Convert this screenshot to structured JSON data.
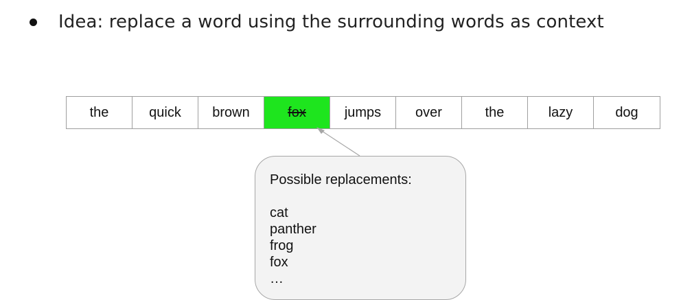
{
  "bullet": {
    "text": "Idea: replace a word using the surrounding words as context"
  },
  "sentence": {
    "words": [
      "the",
      "quick",
      "brown",
      "fox",
      "jumps",
      "over",
      "the",
      "lazy",
      "dog"
    ],
    "target_index": 3,
    "target_color": "#1ee51e"
  },
  "callout": {
    "title": "Possible replacements:",
    "items": [
      "cat",
      "panther",
      "frog",
      "fox",
      "…"
    ]
  }
}
